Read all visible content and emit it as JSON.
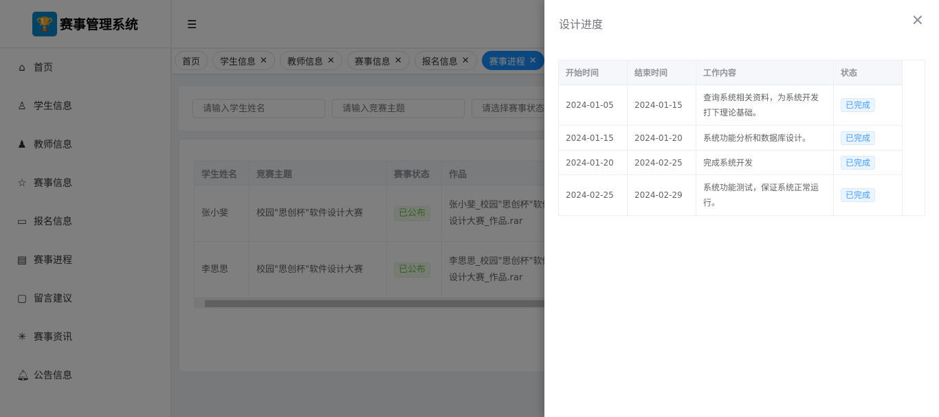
{
  "app": {
    "title": "赛事管理系统"
  },
  "sidebar": {
    "items": [
      {
        "label": "首页",
        "icon": "home-icon"
      },
      {
        "label": "学生信息",
        "icon": "user-icon"
      },
      {
        "label": "教师信息",
        "icon": "teacher-icon"
      },
      {
        "label": "赛事信息",
        "icon": "star-icon"
      },
      {
        "label": "报名信息",
        "icon": "form-icon"
      },
      {
        "label": "赛事进程",
        "icon": "progress-icon"
      },
      {
        "label": "留言建议",
        "icon": "chat-icon"
      },
      {
        "label": "赛事资讯",
        "icon": "loading-icon"
      },
      {
        "label": "公告信息",
        "icon": "bell-icon"
      }
    ]
  },
  "tabs": [
    {
      "label": "首页"
    },
    {
      "label": "学生信息"
    },
    {
      "label": "教师信息"
    },
    {
      "label": "赛事信息"
    },
    {
      "label": "报名信息"
    },
    {
      "label": "赛事进程",
      "active": true
    }
  ],
  "search": {
    "name_placeholder": "请输入学生姓名",
    "topic_placeholder": "请输入竞赛主题",
    "status_placeholder": "请选择赛事状态"
  },
  "table": {
    "headers": [
      "学生姓名",
      "竞赛主题",
      "赛事状态",
      "作品"
    ],
    "rows": [
      {
        "name": "张小斐",
        "topic": "校园\"思创杯\"软件设计大赛",
        "status": "已公布",
        "work": "张小斐_校园\"思创杯\"软件设计大赛_作品.rar"
      },
      {
        "name": "李思思",
        "topic": "校园\"思创杯\"软件设计大赛",
        "status": "已公布",
        "work": "李思思_校园\"思创杯\"软件设计大赛_作品.rar"
      }
    ]
  },
  "drawer": {
    "title": "设计进度",
    "headers": [
      "开始时间",
      "结束时间",
      "工作内容",
      "状态"
    ],
    "rows": [
      {
        "start": "2024-01-05",
        "end": "2024-01-15",
        "content": "查询系统相关资料，为系统开发打下理论基础。",
        "status": "已完成"
      },
      {
        "start": "2024-01-15",
        "end": "2024-01-20",
        "content": "系统功能分析和数据库设计。",
        "status": "已完成"
      },
      {
        "start": "2024-01-20",
        "end": "2024-02-25",
        "content": "完成系统开发",
        "status": "已完成"
      },
      {
        "start": "2024-02-25",
        "end": "2024-02-29",
        "content": "系统功能测试，保证系统正常运行。",
        "status": "已完成"
      }
    ]
  }
}
